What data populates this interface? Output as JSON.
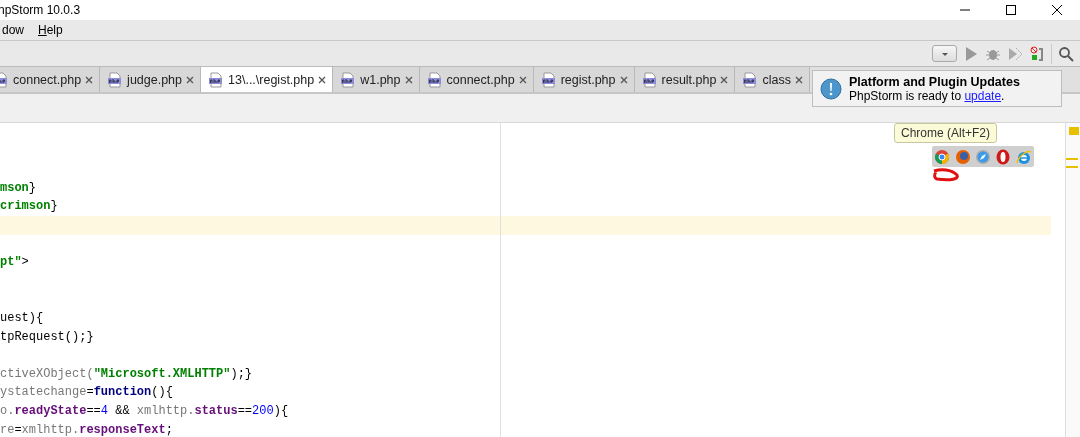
{
  "window": {
    "title": "npStorm 10.0.3"
  },
  "menu": [
    {
      "label": "dow",
      "mnemonic_underlined": false
    },
    {
      "label": "Help",
      "mnemonic_underlined": true
    }
  ],
  "tabs": [
    {
      "label": "connect.php",
      "selected": false
    },
    {
      "label": "judge.php",
      "selected": false
    },
    {
      "label": "13\\...\\regist.php",
      "selected": true
    },
    {
      "label": "w1.php",
      "selected": false
    },
    {
      "label": "connect.php",
      "selected": false
    },
    {
      "label": "regist.php",
      "selected": false
    },
    {
      "label": "result.php",
      "selected": false
    },
    {
      "label": "class",
      "selected": false
    }
  ],
  "editor": {
    "lines": [
      {
        "kind": "blank"
      },
      {
        "kind": "blank"
      },
      {
        "kind": "blank"
      },
      {
        "kind": "code",
        "tokens": [
          {
            "text": "mson",
            "kind": "string"
          },
          {
            "text": "}",
            "kind": "plain"
          }
        ]
      },
      {
        "kind": "code",
        "tokens": [
          {
            "text": "crimson",
            "kind": "string"
          },
          {
            "text": "}",
            "kind": "plain"
          }
        ]
      },
      {
        "kind": "current"
      },
      {
        "kind": "blank"
      },
      {
        "kind": "code",
        "tokens": [
          {
            "text": "pt\"",
            "kind": "string"
          },
          {
            "text": ">",
            "kind": "plain"
          }
        ]
      },
      {
        "kind": "blank"
      },
      {
        "kind": "blank"
      },
      {
        "kind": "code",
        "tokens": [
          {
            "text": "uest){",
            "kind": "plain"
          }
        ]
      },
      {
        "kind": "code",
        "tokens": [
          {
            "text": "tpRequest();}",
            "kind": "plain"
          }
        ]
      },
      {
        "kind": "blank"
      },
      {
        "kind": "code",
        "tokens": [
          {
            "text": "ctiveXObject(",
            "kind": "var"
          },
          {
            "text": "\"Microsoft.XMLHTTP\"",
            "kind": "string"
          },
          {
            "text": ");}",
            "kind": "plain"
          }
        ]
      },
      {
        "kind": "code",
        "tokens": [
          {
            "text": "ystatechange",
            "kind": "var"
          },
          {
            "text": "=",
            "kind": "plain"
          },
          {
            "text": "function",
            "kind": "keyword"
          },
          {
            "text": "(){",
            "kind": "plain"
          }
        ]
      },
      {
        "kind": "code",
        "tokens": [
          {
            "text": "o.",
            "kind": "var"
          },
          {
            "text": "readyState",
            "kind": "property"
          },
          {
            "text": "==",
            "kind": "plain"
          },
          {
            "text": "4",
            "kind": "number"
          },
          {
            "text": " && ",
            "kind": "plain"
          },
          {
            "text": "xmlhttp.",
            "kind": "var"
          },
          {
            "text": "status",
            "kind": "property"
          },
          {
            "text": "==",
            "kind": "plain"
          },
          {
            "text": "200",
            "kind": "number"
          },
          {
            "text": "){",
            "kind": "plain"
          }
        ]
      },
      {
        "kind": "code",
        "tokens": [
          {
            "text": "re",
            "kind": "var"
          },
          {
            "text": "=",
            "kind": "plain"
          },
          {
            "text": "xmlhttp.",
            "kind": "var"
          },
          {
            "text": "responseText",
            "kind": "property"
          },
          {
            "text": ";",
            "kind": "plain"
          }
        ]
      }
    ]
  },
  "tooltip": {
    "text": "Chrome (Alt+F2)"
  },
  "notification": {
    "title": "Platform and Plugin Updates",
    "text_before": "PhpStorm is ready to ",
    "link": "update",
    "text_after": "."
  }
}
